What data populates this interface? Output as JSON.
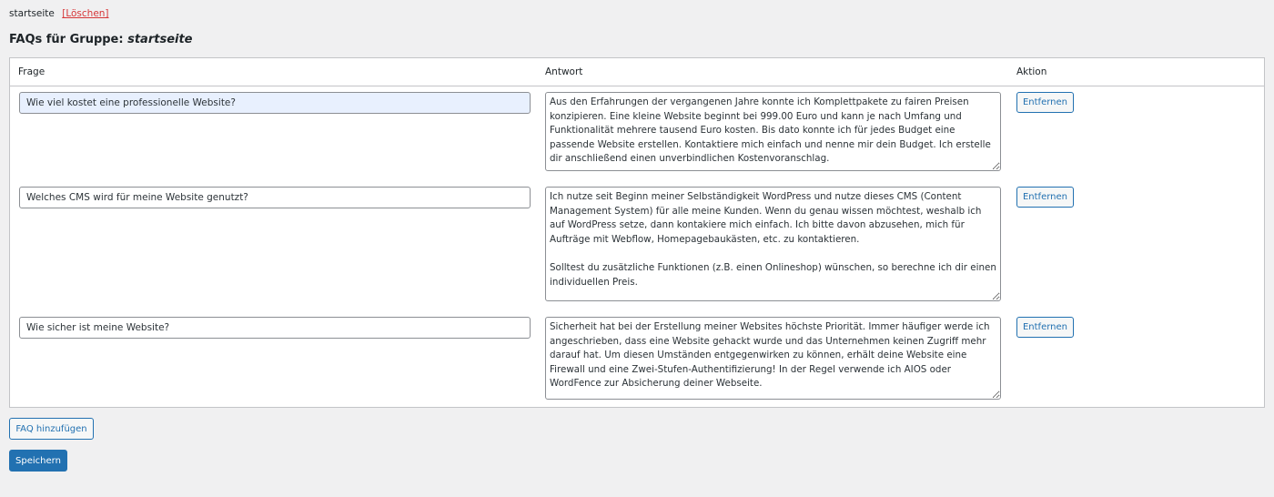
{
  "group": {
    "name": "startseite",
    "delete_label": "[Löschen]"
  },
  "heading": {
    "prefix": "FAQs für Gruppe:",
    "group_name": "startseite"
  },
  "table": {
    "columns": [
      "Frage",
      "Antwort",
      "Aktion"
    ],
    "rows": [
      {
        "question": "Wie viel kostet eine professionelle Website?",
        "answer": "Aus den Erfahrungen der vergangenen Jahre konnte ich Komplettpakete zu fairen Preisen konzipieren. Eine kleine Website beginnt bei 999.00 Euro und kann je nach Umfang und Funktionalität mehrere tausend Euro kosten. Bis dato konnte ich für jedes Budget eine passende Website erstellen. Kontaktiere mich einfach und nenne mir dein Budget. Ich erstelle dir anschließend einen unverbindlichen Kostenvoranschlag.",
        "action_label": "Entfernen"
      },
      {
        "question": "Welches CMS wird für meine Website genutzt?",
        "answer": "Ich nutze seit Beginn meiner Selbständigkeit WordPress und nutze dieses CMS (Content Management System) für alle meine Kunden. Wenn du genau wissen möchtest, weshalb ich auf WordPress setze, dann kontakiere mich einfach. Ich bitte davon abzusehen, mich für Aufträge mit Webflow, Homepagebaukästen, etc. zu kontaktieren.\n\nSolltest du zusätzliche Funktionen (z.B. einen Onlineshop) wünschen, so berechne ich dir einen individuellen Preis.",
        "action_label": "Entfernen"
      },
      {
        "question": "Wie sicher ist meine Website?",
        "answer": "Sicherheit hat bei der Erstellung meiner Websites höchste Priorität. Immer häufiger werde ich angeschrieben, dass eine Website gehackt wurde und das Unternehmen keinen Zugriff mehr darauf hat. Um diesen Umständen entgegenwirken zu können, erhält deine Website eine Firewall und eine Zwei-Stufen-Authentifizierung! In der Regel verwende ich AIOS oder WordFence zur Absicherung deiner Webseite.",
        "action_label": "Entfernen"
      }
    ]
  },
  "actions": {
    "add_label": "FAQ hinzufügen",
    "save_label": "Speichern"
  },
  "colors": {
    "accent": "#2271b1",
    "danger": "#d63638",
    "background": "#f0f0f1"
  }
}
